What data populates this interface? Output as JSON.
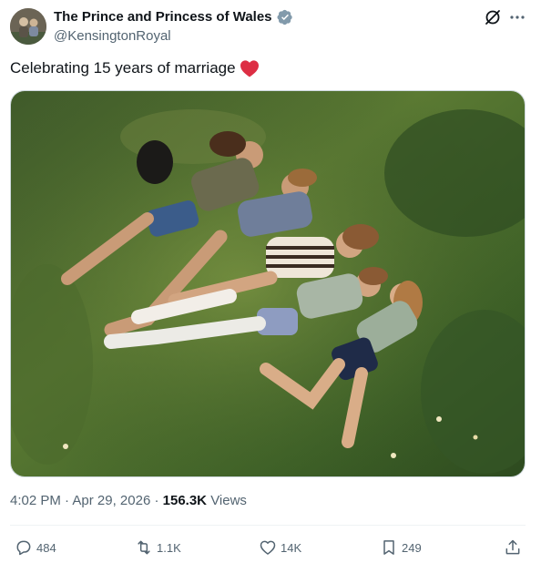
{
  "author": {
    "display_name": "The Prince and Princess of Wales",
    "handle": "@KensingtonRoyal",
    "verified_color": "#829aab"
  },
  "tweet": {
    "text": "Celebrating 15 years of marriage",
    "emoji": "heart-emoji"
  },
  "media": {
    "icon": "photo"
  },
  "meta": {
    "time": "4:02 PM",
    "separator": "·",
    "date": "Apr 29, 2026",
    "views_count": "156.3K",
    "views_label": "Views"
  },
  "actions": {
    "replies": "484",
    "reposts": "1.1K",
    "likes": "14K",
    "bookmarks": "249"
  },
  "colors": {
    "text_primary": "#0f1419",
    "text_secondary": "#536471",
    "heart": "#f91880",
    "divider": "#eff3f4"
  }
}
